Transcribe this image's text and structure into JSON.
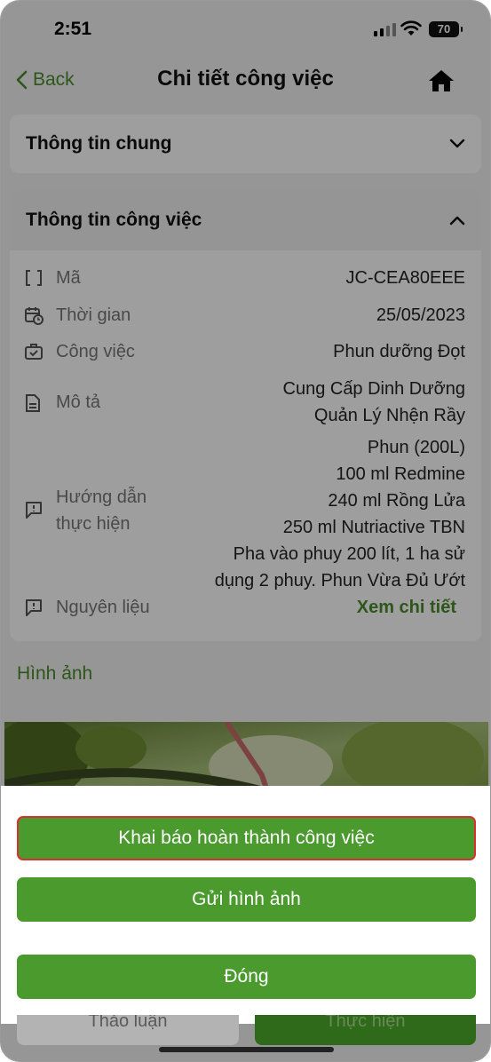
{
  "status_bar": {
    "time": "2:51",
    "battery": "70"
  },
  "nav": {
    "back_label": "Back",
    "title": "Chi tiết công việc"
  },
  "general_section": {
    "title": "Thông tin chung"
  },
  "job_section": {
    "title": "Thông tin công việc",
    "rows": [
      {
        "label": "Mã",
        "value": "JC-CEA80EEE"
      },
      {
        "label": "Thời gian",
        "value": "25/05/2023"
      },
      {
        "label": "Công việc",
        "value": "Phun dưỡng Đọt"
      },
      {
        "label": "Mô tả",
        "value_lines": [
          "Cung Cấp Dinh Dưỡng",
          "Quản Lý Nhện Rầy"
        ]
      },
      {
        "label_lines": [
          "Hướng dẫn",
          "thực hiện"
        ],
        "value_lines": [
          "Phun (200L)",
          "100 ml Redmine",
          "240 ml Rồng Lửa",
          "250 ml Nutriactive TBN",
          "Pha vào phuy 200 lít, 1 ha sử",
          "dụng 2 phuy. Phun Vừa Đủ Ướt"
        ]
      },
      {
        "label": "Nguyên liệu",
        "link": "Xem chi tiết"
      }
    ]
  },
  "images_section": {
    "title": "Hình ảnh"
  },
  "action_sheet": {
    "declare_complete": "Khai báo hoàn thành công việc",
    "send_images": "Gửi hình ảnh",
    "close": "Đóng"
  },
  "bottom_bar": {
    "left": "Thảo luận",
    "right": "Thực hiện"
  },
  "colors": {
    "accent": "#4a9a2e",
    "focus_border": "#d93030"
  }
}
